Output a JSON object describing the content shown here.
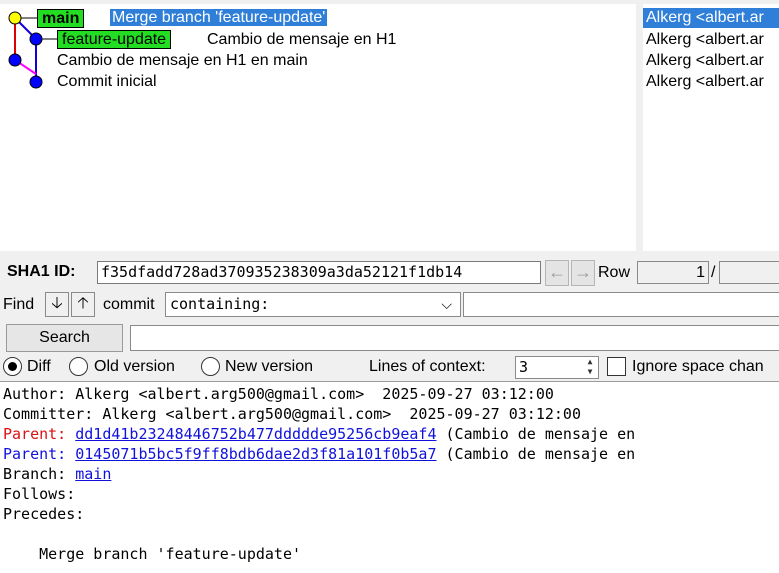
{
  "graph": {
    "commits": [
      {
        "message": "Merge branch 'feature-update'",
        "selected": true,
        "branch": "main"
      },
      {
        "message": "Cambio de mensaje en H1",
        "branch": "feature-update"
      },
      {
        "message": "Cambio de mensaje en H1 en main"
      },
      {
        "message": "Commit inicial"
      }
    ],
    "colors": {
      "main_line": "#dd0000",
      "feature_line": "#1100dd",
      "merge_line": "#ff00ff",
      "head_node": "#ffff00",
      "node": "#0000ff",
      "branch_tag": "#22dd22",
      "selection": "#2f7fd8"
    }
  },
  "authors": [
    "Alkerg <albert.ar",
    "Alkerg <albert.ar",
    "Alkerg <albert.ar",
    "Alkerg <albert.ar"
  ],
  "sha": {
    "label": "SHA1 ID:",
    "value": "f35dfadd728ad370935238309a3da52121f1db14",
    "back_icon": "←",
    "forward_icon": "→",
    "row_label": "Row",
    "row_value": "1",
    "row_sep": "/"
  },
  "find": {
    "label": "Find",
    "down_icon": "🡣",
    "up_icon": "🡡",
    "commit_label": "commit",
    "type_value": "containing:",
    "chevron": "⌵"
  },
  "search": {
    "button_label": "Search"
  },
  "diff_options": {
    "diff_label": "Diff",
    "old_label": "Old version",
    "new_label": "New version",
    "context_label": "Lines of context:",
    "context_value": "3",
    "ignore_label": "Ignore space chan"
  },
  "details": {
    "author": "Author: Alkerg <albert.arg500@gmail.com>  2025-09-27 03:12:00",
    "committer": "Committer: Alkerg <albert.arg500@gmail.com>  2025-09-27 03:12:00",
    "parent1_label": "Parent: ",
    "parent1_sha": "dd1d41b23248446752b477ddddde95256cb9eaf4",
    "parent1_desc": " (Cambio de mensaje en",
    "parent2_label": "Parent: ",
    "parent2_sha": "0145071b5bc5f9ff8bdb6dae2d3f81a101f0b5a7",
    "parent2_desc": " (Cambio de mensaje en",
    "branch_label": "Branch: ",
    "branch_value": "main",
    "follows": "Follows:",
    "precedes": "Precedes:",
    "message": "    Merge branch 'feature-update'"
  }
}
